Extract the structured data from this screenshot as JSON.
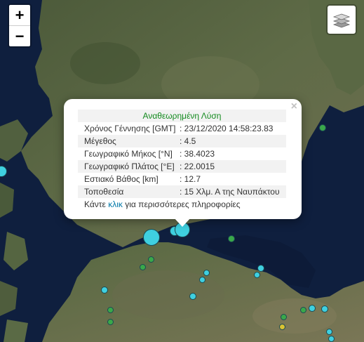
{
  "map": {
    "zoom_in": "+",
    "zoom_out": "−",
    "layers_icon": "layers-stack-icon"
  },
  "popup": {
    "close": "×",
    "title": "Αναθεωρημένη Λύση",
    "rows": [
      {
        "label": "Χρόνος Γέννησης [GMT]",
        "value": ": 23/12/2020 14:58:23.83"
      },
      {
        "label": "Μέγεθος",
        "value": ": 4.5"
      },
      {
        "label": "Γεωγραφικό Μήκος [°N]",
        "value": ": 38.4023"
      },
      {
        "label": "Γεωγραφικό Πλάτος [°E]",
        "value": ": 22.0015"
      },
      {
        "label": "Εστιακό Βάθος [km]",
        "value": ": 12.7"
      },
      {
        "label": "Τοποθεσία",
        "value": ": 15 Χλμ. Α της Ναυπάκτου"
      }
    ],
    "more_prefix": "Κάντε ",
    "more_link": "κλικ",
    "more_suffix": " για περισσότερες πληροφορίες"
  },
  "colors": {
    "recent_quake": "#3fd0e0",
    "older_quake": "#3aa84a",
    "yellow_quake": "#d9c233",
    "title_green": "#138a1e",
    "link_blue": "#0078a8"
  }
}
